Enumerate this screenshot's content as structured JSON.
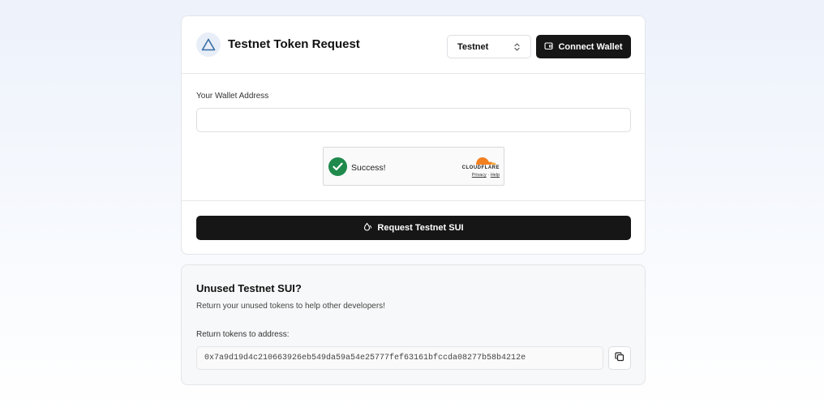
{
  "header": {
    "title": "Testnet Token Request",
    "network_selected": "Testnet",
    "connect_label": "Connect Wallet"
  },
  "form": {
    "address_label": "Your Wallet Address",
    "address_value": "",
    "address_placeholder": "",
    "request_label": "Request Testnet SUI"
  },
  "captcha": {
    "message": "Success!",
    "brand": "CLOUDFLARE",
    "privacy": "Privacy",
    "separator": "·",
    "help": "Help"
  },
  "return_section": {
    "title": "Unused Testnet SUI?",
    "description": "Return your unused tokens to help other developers!",
    "address_label": "Return tokens to address:",
    "address": "0x7a9d19d4c210663926eb549da59a54e25777fef63161bfccda08277b58b4212e"
  },
  "icons": {
    "logo": "triangle-logo-icon",
    "select": "chevron-up-down-icon",
    "wallet": "wallet-icon",
    "faucet": "droplet-icon",
    "check": "check-icon",
    "copy": "copy-icon"
  },
  "colors": {
    "primary_button": "#161616",
    "logo_accent": "#3a6ea5",
    "captcha_success": "#1f8a4c",
    "cloudflare_orange": "#f38020"
  }
}
